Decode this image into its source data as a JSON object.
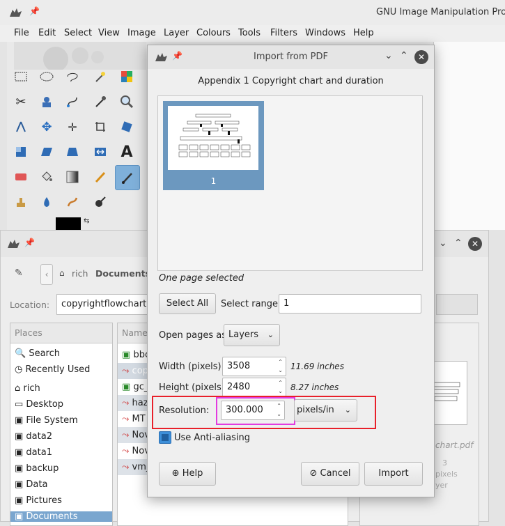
{
  "gimp_window": {
    "title": "GNU Image Manipulation Prog",
    "menu": [
      "File",
      "Edit",
      "Select",
      "View",
      "Image",
      "Layer",
      "Colours",
      "Tools",
      "Filters",
      "Windows",
      "Help"
    ]
  },
  "file_dialog": {
    "breadcrumb": [
      "rich",
      "Documents"
    ],
    "location_label": "Location:",
    "location_value": "copyrightflowchart.p",
    "places_header": "Places",
    "places": [
      "Search",
      "Recently Used",
      "rich",
      "Desktop",
      "File System",
      "data2",
      "data1",
      "backup",
      "Data",
      "Pictures",
      "Documents"
    ],
    "files_header": "Name",
    "files": [
      "bbc",
      "cop",
      "gc_",
      "haz",
      "MT",
      "Nov",
      "Nov",
      "vm_"
    ],
    "preview_name": "chart.pdf",
    "preview_meta": [
      "3",
      "pixels",
      "yer"
    ]
  },
  "import_dialog": {
    "title": "Import from PDF",
    "doc_title": "Appendix 1 Copyright chart and duration",
    "page_number": "1",
    "selection_status": "One page selected",
    "select_all": "Select All",
    "select_range_label": "Select range:",
    "select_range_value": "1",
    "open_as_label": "Open pages as",
    "open_as_value": "Layers",
    "width_label": "Width (pixels):",
    "width_value": "3508",
    "width_inches": "11.69 inches",
    "height_label": "Height (pixels):",
    "height_value": "2480",
    "height_inches": "8.27 inches",
    "resolution_label": "Resolution:",
    "resolution_value": "300.000",
    "resolution_unit": "pixels/in",
    "antialias_label": "Use Anti-aliasing",
    "antialias_checked": true,
    "help": "Help",
    "cancel": "Cancel",
    "import": "Import"
  },
  "colors": {
    "selected_page": "#6c98bf",
    "red_highlight": "#e8202a",
    "magenta_highlight": "#e23be0",
    "checkbox": "#3d8fd9"
  }
}
